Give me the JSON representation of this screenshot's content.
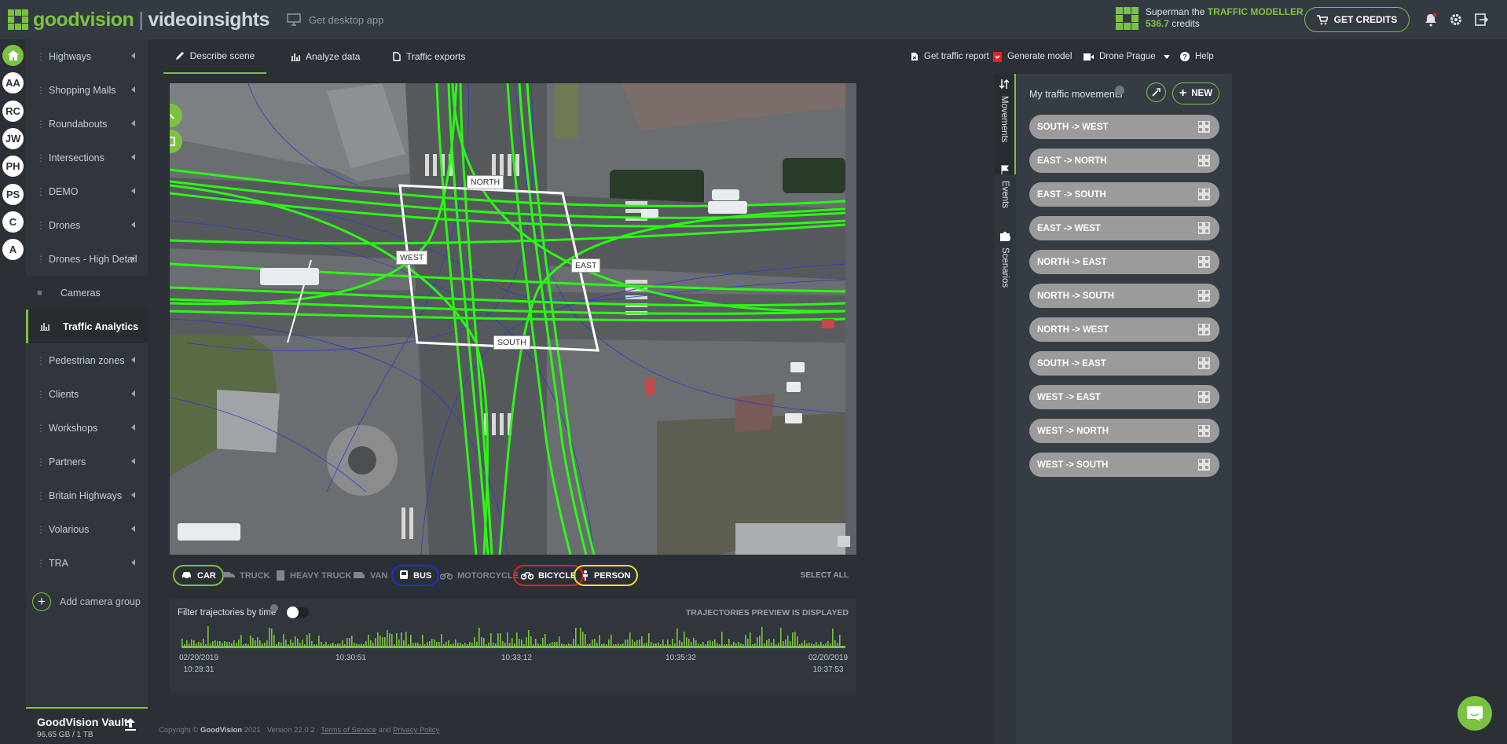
{
  "header": {
    "brand_good": "goodvision",
    "brand_sep": "|",
    "brand_video": "videoinsights",
    "desktop_app": "Get desktop app",
    "user_prefix": "Superman the",
    "user_role": "TRAFFIC MODELLER",
    "credits_value": "536.7",
    "credits_label": "credits",
    "get_credits": "GET CREDITS"
  },
  "rail": {
    "avatars": [
      "AA",
      "RC",
      "JW",
      "PH",
      "PS",
      "C",
      "A"
    ]
  },
  "sidebar": {
    "groups": [
      "Highways",
      "Shopping Malls",
      "Roundabouts",
      "Intersections",
      "DEMO",
      "Drones",
      "Drones - High Detail"
    ],
    "sub_items": [
      "Cameras",
      "Traffic Analytics"
    ],
    "groups_after": [
      "Pedestrian zones",
      "Clients",
      "Workshops",
      "Partners",
      "Britain Highways",
      "Volarious",
      "TRA"
    ],
    "add_group": "Add camera group",
    "vault_title": "GoodVision Vault",
    "vault_size": "96.65 GB / 1 TB"
  },
  "nav": {
    "tabs": [
      "Describe scene",
      "Analyze data",
      "Traffic exports"
    ],
    "report": "Get traffic report",
    "model": "Generate model",
    "camera": "Drone Prague",
    "help": "Help"
  },
  "scene": {
    "zones": [
      "NORTH",
      "WEST",
      "EAST",
      "SOUTH"
    ]
  },
  "filters": {
    "classes": [
      "CAR",
      "TRUCK",
      "HEAVY TRUCK",
      "VAN",
      "BUS",
      "MOTORCYCLE",
      "BICYCLE",
      "PERSON"
    ],
    "select_all": "SELECT ALL",
    "colors": {
      "car": "#7cc242",
      "bus": "#1c2fd4",
      "bicycle": "#e02424",
      "person": "#f1e12a"
    }
  },
  "timeline": {
    "title": "Filter trajectories by time",
    "status": "TRAJECTORIES PREVIEW IS DISPLAYED",
    "start_date": "02/20/2019",
    "start_time": "10:28:31",
    "t1": "10:30:51",
    "t2": "10:33:12",
    "t3": "10:35:32",
    "end_date": "02/20/2019",
    "end_time": "10:37:53"
  },
  "footer": {
    "copyright": "Copyright ©",
    "brand": "GoodVision",
    "year": "2021",
    "version": "Version 22.0.2",
    "terms": "Terms of Service",
    "and": "and",
    "privacy": "Privacy Policy"
  },
  "right": {
    "vtabs": [
      "Movements",
      "Events",
      "Scenarios"
    ],
    "title": "My traffic movements",
    "new_label": "NEW",
    "movements": [
      "SOUTH -> WEST",
      "EAST -> NORTH",
      "EAST -> SOUTH",
      "EAST -> WEST",
      "NORTH -> EAST",
      "NORTH -> SOUTH",
      "NORTH -> WEST",
      "SOUTH -> EAST",
      "WEST -> EAST",
      "WEST -> NORTH",
      "WEST -> SOUTH"
    ]
  },
  "colors": {
    "accent": "#7cc242"
  }
}
